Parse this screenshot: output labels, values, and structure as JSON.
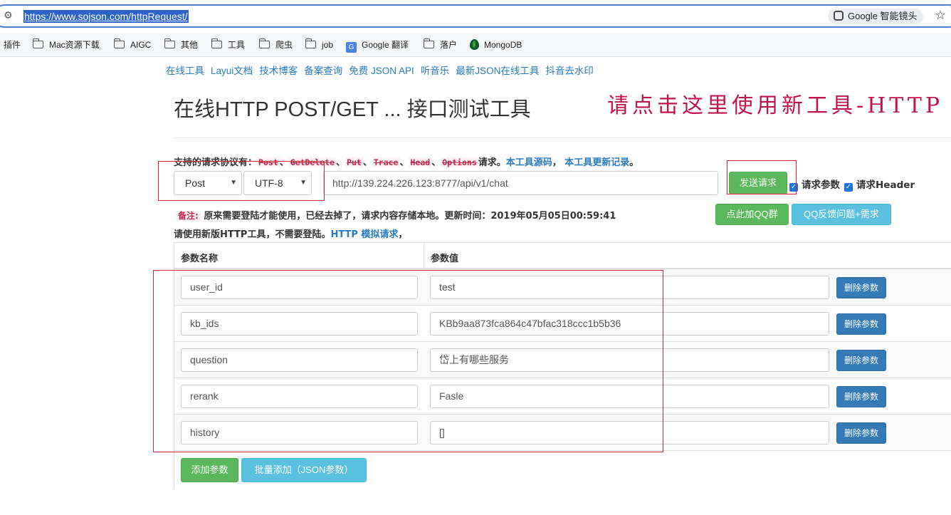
{
  "browser": {
    "url": "https://www.sojson.com/httpRequest/",
    "lens_label": "Google 智能镜头",
    "bookmarks": [
      "插件",
      "Mac资源下载",
      "AIGC",
      "其他",
      "工具",
      "爬虫",
      "job",
      "Google 翻译",
      "落户",
      "MongoDB"
    ]
  },
  "nav": [
    "在线工具",
    "Layui文档",
    "技术博客",
    "备案查询",
    "免费 JSON API",
    "听音乐",
    "最新JSON在线工具",
    "抖音去水印"
  ],
  "page": {
    "title": "在线HTTP POST/GET ... 接口测试工具",
    "promo": "请点击这里使用新工具-HTTP"
  },
  "protocols": {
    "prefix": "支持的请求协议有：",
    "items": [
      "Post",
      "GetDelete",
      "Put",
      "Trace",
      "Head",
      "Options"
    ],
    "separator": "、",
    "suffix": "请求。",
    "source_link": "本工具源码",
    "comma": "，",
    "changelog_link": "本工具更新记录",
    "end": "。"
  },
  "request": {
    "method": "Post",
    "charset": "UTF-8",
    "url": "http://139.224.226.123:8777/api/v1/chat",
    "send_label": "发送请求",
    "opt_params": "请求参数",
    "opt_header": "请求Header",
    "qq_group_label": "点此加QQ群",
    "qq_feedback_label": "QQ反馈问题+需求"
  },
  "notes": {
    "tag": "备注:",
    "text": "原来需要登陆才能使用，已经去掉了，请求内容存储本地。更新时间：2019年05月05日00:59:41",
    "hint_prefix": "请使用新版HTTP工具，不需要登陆。",
    "hint_link": "HTTP 模拟请求",
    "hint_suffix": "，"
  },
  "table": {
    "col_name": "参数名称",
    "col_value": "参数值",
    "delete_label": "删除参数",
    "rows": [
      {
        "name": "user_id",
        "value": "test"
      },
      {
        "name": "kb_ids",
        "value": "KBb9aa873fca864c47bfac318ccc1b5b36"
      },
      {
        "name": "question",
        "value": "岱上有哪些服务"
      },
      {
        "name": "rerank",
        "value": "Fasle"
      },
      {
        "name": "history",
        "value": "[]"
      }
    ],
    "add_label": "添加参数",
    "bulk_add_label": "批量添加（JSON参数）"
  },
  "colors": {
    "accent_green": "#5cb85c",
    "accent_cyan": "#5bc0de",
    "accent_blue": "#337ab7",
    "link": "#2a7bc0",
    "annotation_red": "#d9252f",
    "promo": "#c0124a"
  }
}
